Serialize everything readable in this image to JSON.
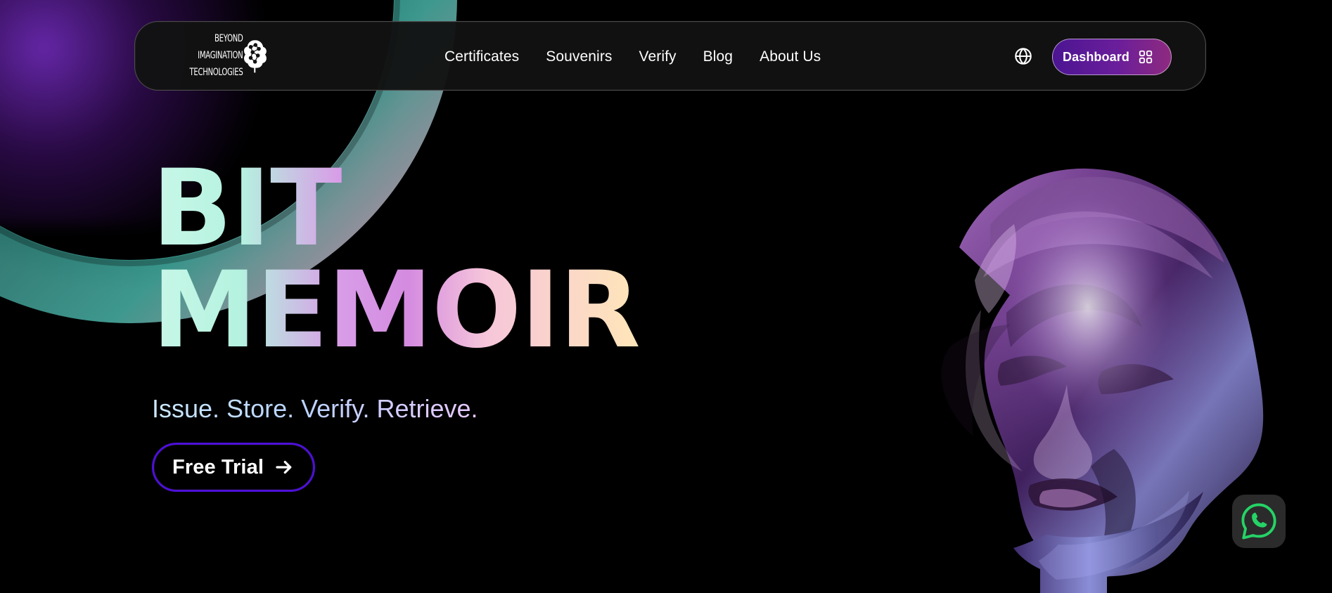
{
  "header": {
    "logo": {
      "lines": [
        "BEYOND",
        "IMAGINATION",
        "TECHNOLOGIES"
      ],
      "icon": "brain-network-icon"
    },
    "nav": [
      {
        "label": "Certificates"
      },
      {
        "label": "Souvenirs"
      },
      {
        "label": "Verify"
      },
      {
        "label": "Blog"
      },
      {
        "label": "About Us"
      }
    ],
    "language_icon": "globe-icon",
    "dashboard_button": {
      "label": "Dashboard",
      "icon": "grid-icon"
    }
  },
  "hero": {
    "title_lines": [
      "BIT",
      "MEMOIR"
    ],
    "tagline": "Issue. Store. Verify. Retrieve.",
    "cta": {
      "label": "Free Trial",
      "icon": "arrow-right-icon"
    }
  },
  "widgets": {
    "whatsapp_icon": "whatsapp-icon"
  },
  "colors": {
    "background": "#000000",
    "header_bg": "#121212",
    "dashboard_gradient_start": "#4b1592",
    "dashboard_gradient_end": "#8e2a7f",
    "cta_border": "#4d10d9",
    "whatsapp_bg": "#2b2b2b",
    "whatsapp_green": "#25d366"
  }
}
